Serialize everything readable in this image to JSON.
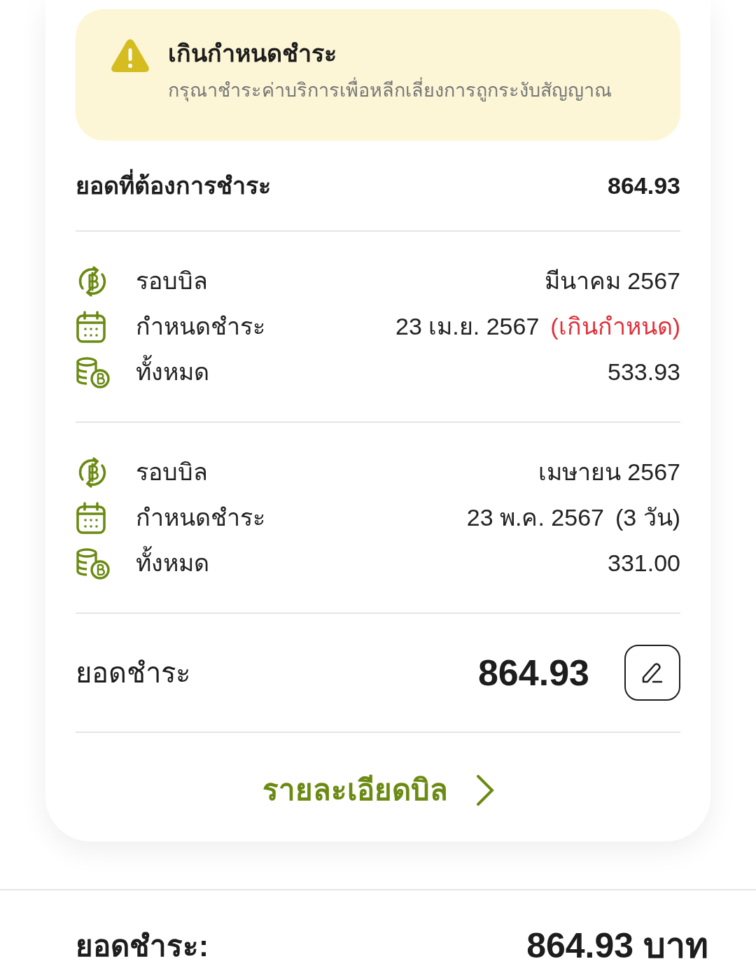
{
  "alert": {
    "title": "เกินกำหนดชำระ",
    "message": "กรุณาชำระค่าบริการเพื่อหลีกเลี่ยงการถูกระงับสัญญาณ"
  },
  "amount_due": {
    "label": "ยอดที่ต้องการชำระ",
    "value": "864.93"
  },
  "bills": [
    {
      "rows": [
        {
          "kind": "cycle",
          "label": "รอบบิล",
          "value": "มีนาคม 2567"
        },
        {
          "kind": "due",
          "label": "กำหนดชำระ",
          "value": "23 เม.ย. 2567",
          "note": "(เกินกำหนด)",
          "overdue": true
        },
        {
          "kind": "total",
          "label": "ทั้งหมด",
          "value": "533.93"
        }
      ]
    },
    {
      "rows": [
        {
          "kind": "cycle",
          "label": "รอบบิล",
          "value": "เมษายน 2567"
        },
        {
          "kind": "due",
          "label": "กำหนดชำระ",
          "value": "23 พ.ค. 2567",
          "note": "(3 วัน)",
          "overdue": false
        },
        {
          "kind": "total",
          "label": "ทั้งหมด",
          "value": "331.00"
        }
      ]
    }
  ],
  "payment": {
    "label": "ยอดชำระ",
    "value": "864.93"
  },
  "details_link": "รายละเอียดบิล",
  "footer": {
    "label": "ยอดชำระ:",
    "value": "864.93 บาท"
  }
}
